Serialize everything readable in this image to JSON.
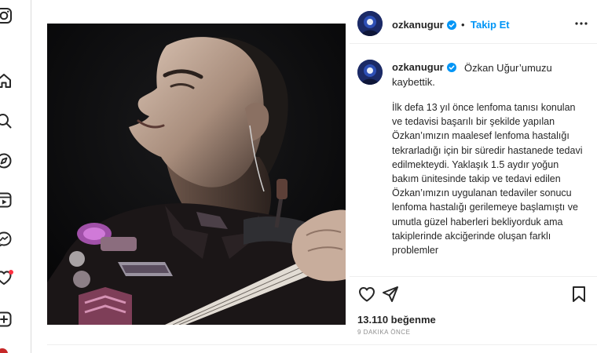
{
  "nav": {
    "items": [
      {
        "name": "instagram-logo-icon"
      },
      {
        "name": "home-icon"
      },
      {
        "name": "search-icon"
      },
      {
        "name": "explore-icon"
      },
      {
        "name": "reels-icon"
      },
      {
        "name": "messages-icon"
      },
      {
        "name": "notifications-icon",
        "badge": true
      },
      {
        "name": "create-icon"
      }
    ]
  },
  "post": {
    "username": "ozkanugur",
    "separator": "•",
    "follow_label": "Takip Et",
    "caption_lead": "Özkan Uğur’umuzu kaybettik.",
    "caption_body": "İlk defa 13 yıl önce lenfoma tanısı konulan ve tedavisi başarılı bir şekilde yapılan Özkan’ımızın maalesef lenfoma hastalığı tekrarladığı için bir süredir hastanede tedavi edilmekteydi. Yaklaşık 1.5 aydır yoğun bakım ünitesinde takip ve tedavi edilen Özkan’ımızın uygulanan tedaviler sonucu lenfoma hastalığı gerilemeye başlamıştı ve umutla güzel haberleri bekliyorduk ama takiplerinde akciğerinde oluşan farklı problemler",
    "likes": "13.110 beğenme",
    "time": "9 dakika önce"
  },
  "colors": {
    "accent": "#0095f6",
    "text": "#262626",
    "muted": "#8e8e8e",
    "badge": "#ff3040"
  }
}
